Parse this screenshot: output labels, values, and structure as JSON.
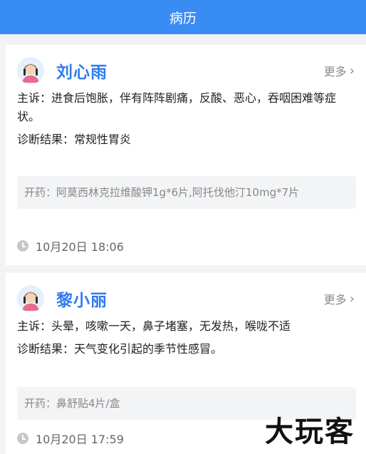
{
  "header": {
    "title": "病历"
  },
  "records": [
    {
      "name": "刘心雨",
      "more": "更多",
      "complaint": "主诉：进食后饱胀，伴有阵阵剧痛，反酸、恶心，吞咽困难等症状。",
      "diagnosis": "诊断结果：常规性胃炎",
      "prescription": "开药：阿莫西林克拉维酸钾1g*6片,阿托伐他汀10mg*7片",
      "time": "10月20日 18:06"
    },
    {
      "name": "黎小丽",
      "more": "更多",
      "complaint": "主诉：头晕，咳嗽一天，鼻子堵塞，无发热，喉咙不适",
      "diagnosis": "诊断结果：天气变化引起的季节性感冒。",
      "prescription": "开药：鼻舒贴4片/盒",
      "time": "10月20日 17:59"
    }
  ],
  "watermark": "大玩客",
  "icons": {
    "avatar": "female-avatar-icon",
    "more": "chevron-right-icon",
    "time": "clock-icon"
  },
  "colors": {
    "header": "#3a8cf5",
    "name": "#2f7bee"
  }
}
